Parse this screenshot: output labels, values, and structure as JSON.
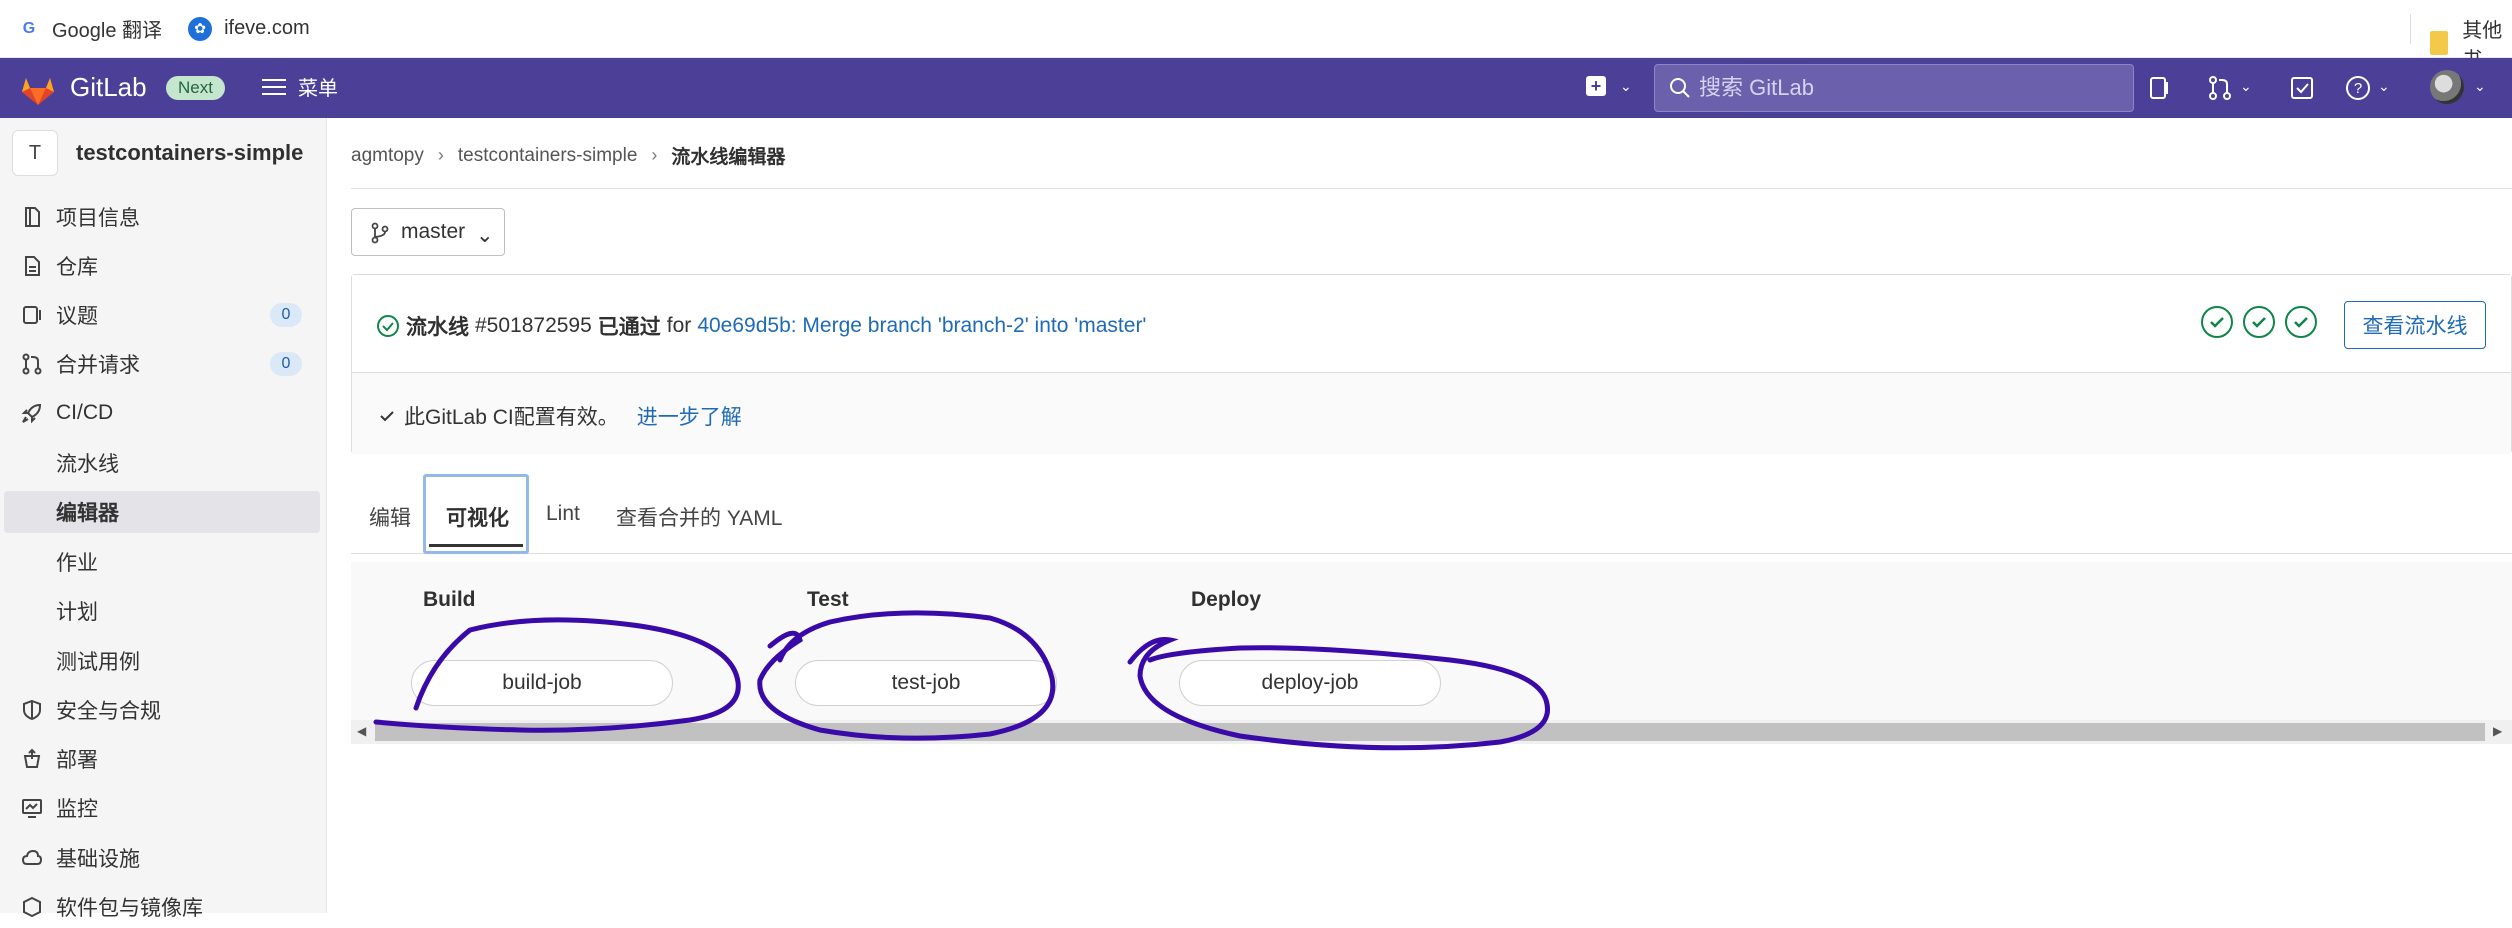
{
  "browser": {
    "bookmarks": [
      {
        "label": "Google 翻译",
        "icon": "google-translate-icon"
      },
      {
        "label": "ifeve.com",
        "icon": "site-icon"
      }
    ],
    "other_bookmarks": "其他书"
  },
  "topnav": {
    "brand": "GitLab",
    "badge": "Next",
    "menu_label": "菜单",
    "search_placeholder": "搜索 GitLab",
    "bg_color": "#4b3f98"
  },
  "sidebar": {
    "project_avatar": "T",
    "project_name": "testcontainers-simple",
    "items": [
      {
        "label": "项目信息",
        "icon": "info-icon"
      },
      {
        "label": "仓库",
        "icon": "document-icon"
      },
      {
        "label": "议题",
        "icon": "issues-icon",
        "count": "0"
      },
      {
        "label": "合并请求",
        "icon": "merge-request-icon",
        "count": "0"
      },
      {
        "label": "CI/CD",
        "icon": "rocket-icon"
      }
    ],
    "cicd_sub": [
      {
        "label": "流水线"
      },
      {
        "label": "编辑器",
        "active": true
      },
      {
        "label": "作业"
      },
      {
        "label": "计划"
      },
      {
        "label": "测试用例"
      }
    ],
    "items_after": [
      {
        "label": "安全与合规",
        "icon": "shield-icon"
      },
      {
        "label": "部署",
        "icon": "deploy-icon"
      },
      {
        "label": "监控",
        "icon": "monitor-icon"
      },
      {
        "label": "基础设施",
        "icon": "cloud-icon"
      },
      {
        "label": "软件包与镜像库",
        "icon": "package-icon"
      }
    ]
  },
  "breadcrumb": {
    "items": [
      "agmtopy",
      "testcontainers-simple",
      "流水线编辑器"
    ]
  },
  "branch": {
    "label": "master"
  },
  "pipeline": {
    "prefix": "流水线",
    "id": "#501872595",
    "status": "已通过",
    "for": "for",
    "commit": "40e69d5b: Merge branch 'branch-2' into 'master'",
    "view_button": "查看流水线",
    "stage_count": 3,
    "success_color": "#108548"
  },
  "validation": {
    "text": "此GitLab CI配置有效。",
    "link": "进一步了解"
  },
  "tabs": [
    "编辑",
    "可视化",
    "Lint",
    "查看合并的 YAML"
  ],
  "active_tab": "可视化",
  "stages": [
    {
      "name": "Build",
      "job": "build-job"
    },
    {
      "name": "Test",
      "job": "test-job"
    },
    {
      "name": "Deploy",
      "job": "deploy-job"
    }
  ],
  "annotation_color": "#3a0aa8"
}
